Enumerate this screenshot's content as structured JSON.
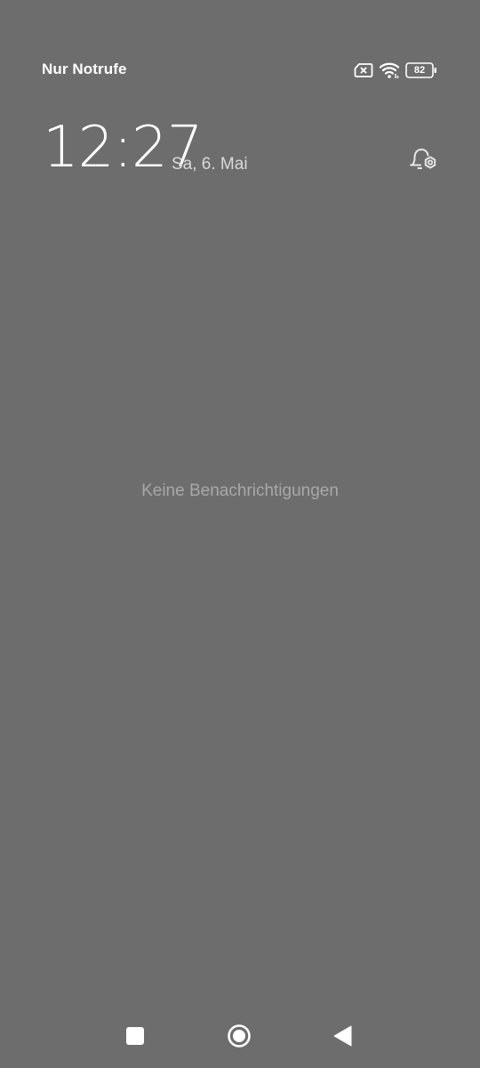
{
  "status_bar": {
    "carrier": "Nur Notrufe",
    "battery_level": "82",
    "icons": [
      "no-sim-icon",
      "wifi-icon",
      "battery-icon"
    ]
  },
  "lockscreen": {
    "time": "12:27",
    "date": "Sa, 6. Mai",
    "empty_notifications": "Keine Benachrichtigungen"
  },
  "navigation": {
    "buttons": [
      "recents-icon",
      "home-icon",
      "back-icon"
    ]
  },
  "colors": {
    "background": "#6d6d6d",
    "text": "#ffffff",
    "muted_text": "#a8a8a8"
  }
}
